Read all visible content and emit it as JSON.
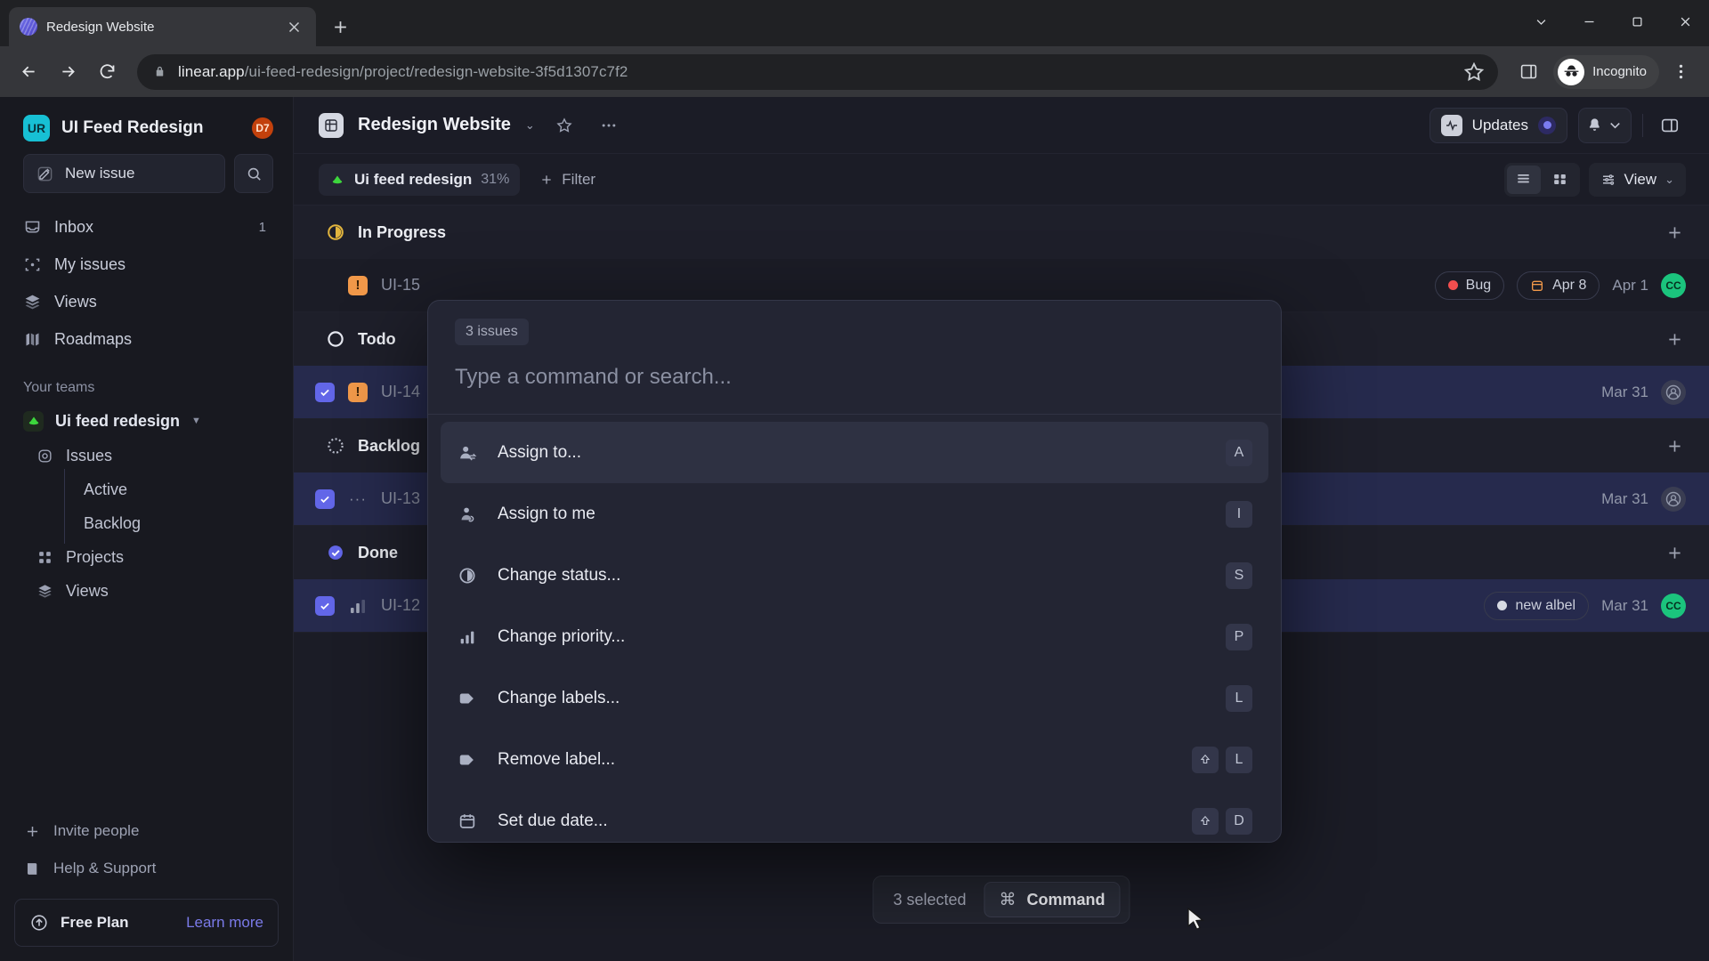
{
  "browser": {
    "tab_title": "Redesign Website",
    "url_domain": "linear.app",
    "url_path": "/ui-feed-redesign/project/redesign-website-3f5d1307c7f2",
    "profile_label": "Incognito"
  },
  "sidebar": {
    "workspace_name": "UI Feed Redesign",
    "workspace_initials": "UR",
    "workspace_badge": "D7",
    "new_issue_label": "New issue",
    "nav": [
      {
        "label": "Inbox",
        "count": "1"
      },
      {
        "label": "My issues",
        "count": ""
      },
      {
        "label": "Views",
        "count": ""
      },
      {
        "label": "Roadmaps",
        "count": ""
      }
    ],
    "teams_heading": "Your teams",
    "team_name": "Ui feed redesign",
    "team_children": [
      {
        "label": "Issues"
      },
      {
        "label": "Active"
      },
      {
        "label": "Backlog"
      },
      {
        "label": "Projects"
      },
      {
        "label": "Views"
      }
    ],
    "invite_label": "Invite people",
    "help_label": "Help & Support",
    "plan_name": "Free Plan",
    "plan_link": "Learn more"
  },
  "topbar": {
    "project_title": "Redesign Website",
    "updates_label": "Updates"
  },
  "filterbar": {
    "project_chip": "Ui feed redesign",
    "project_progress": "31%",
    "filter_label": "Filter",
    "view_label": "View"
  },
  "groups": [
    {
      "name": "In Progress",
      "status": "in-progress",
      "issues": [
        {
          "id": "UI-15",
          "selected": false,
          "priority": "urgent",
          "label": "Bug",
          "label_color": "#f24e4e",
          "due": "Apr 8",
          "date": "Apr 1",
          "avatar": "CC"
        }
      ]
    },
    {
      "name": "Todo",
      "status": "todo",
      "issues": [
        {
          "id": "UI-14",
          "selected": true,
          "priority": "urgent",
          "label": "",
          "label_color": "",
          "due": "",
          "date": "Mar 31",
          "avatar": ""
        }
      ]
    },
    {
      "name": "Backlog",
      "status": "backlog",
      "issues": [
        {
          "id": "UI-13",
          "selected": true,
          "priority": "none",
          "label": "",
          "label_color": "",
          "due": "",
          "date": "Mar 31",
          "avatar": ""
        }
      ]
    },
    {
      "name": "Done",
      "status": "done",
      "issues": [
        {
          "id": "UI-12",
          "selected": true,
          "priority": "medium",
          "label": "new albel",
          "label_color": "#d7dae2",
          "due": "",
          "date": "Mar 31",
          "avatar": "CC"
        }
      ]
    }
  ],
  "palette": {
    "badge": "3 issues",
    "placeholder": "Type a command or search...",
    "items": [
      {
        "label": "Assign to...",
        "icon": "assign-to-icon",
        "keys": [
          "A"
        ],
        "active": true
      },
      {
        "label": "Assign to me",
        "icon": "assign-to-me-icon",
        "keys": [
          "I"
        ],
        "active": false
      },
      {
        "label": "Change status...",
        "icon": "status-icon",
        "keys": [
          "S"
        ],
        "active": false
      },
      {
        "label": "Change priority...",
        "icon": "priority-icon",
        "keys": [
          "P"
        ],
        "active": false
      },
      {
        "label": "Change labels...",
        "icon": "label-icon",
        "keys": [
          "L"
        ],
        "active": false
      },
      {
        "label": "Remove label...",
        "icon": "label-icon",
        "keys": [
          "shift",
          "L"
        ],
        "active": false
      },
      {
        "label": "Set due date...",
        "icon": "calendar-icon",
        "keys": [
          "shift",
          "D"
        ],
        "active": false
      }
    ]
  },
  "cmdbar": {
    "selected_count": "3 selected",
    "command_label": "Command",
    "command_glyph": "⌘"
  },
  "colors": {
    "accent": "#6266e8",
    "urgent": "#f2994a",
    "in_progress": "#e2b53e",
    "done": "#6266e8",
    "team_green": "#3dd63d",
    "avatar_green": "#1bc47d",
    "workspace_teal": "#17c0d4"
  }
}
